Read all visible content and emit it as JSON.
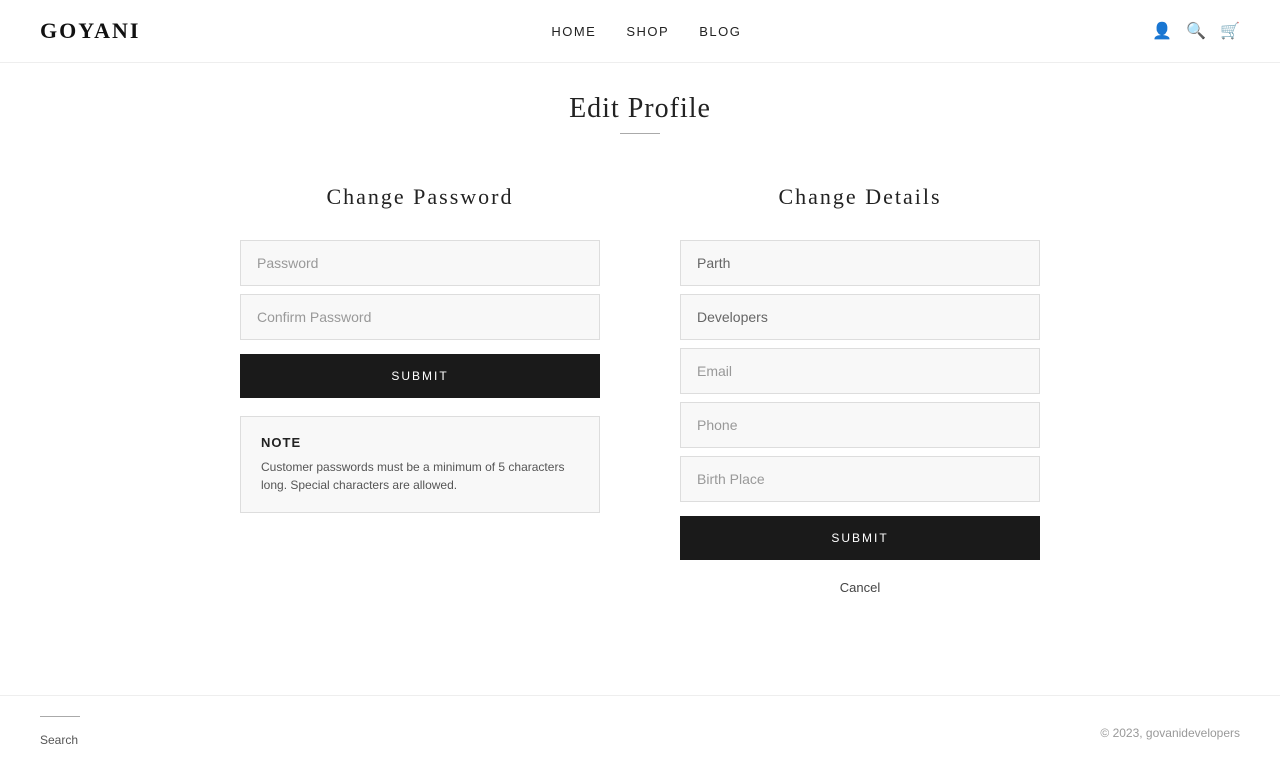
{
  "brand": {
    "logo": "GOYANI"
  },
  "nav": {
    "links": [
      {
        "label": "HOME",
        "id": "home"
      },
      {
        "label": "SHOP",
        "id": "shop"
      },
      {
        "label": "BLOG",
        "id": "blog"
      }
    ],
    "icons": {
      "account": "👤",
      "search": "🔍",
      "cart": "🛒"
    }
  },
  "page": {
    "title": "Edit Profile"
  },
  "change_password": {
    "section_title": "Change Password",
    "password_placeholder": "Password",
    "confirm_placeholder": "Confirm Password",
    "submit_label": "SUBMIT",
    "note": {
      "title": "NOTE",
      "text": "Customer passwords must be a minimum of 5 characters long. Special characters are allowed."
    }
  },
  "change_details": {
    "section_title": "Change Details",
    "first_name_value": "Parth",
    "last_name_value": "Developers",
    "email_placeholder": "Email",
    "phone_placeholder": "Phone",
    "birth_place_placeholder": "Birth Place",
    "submit_label": "SUBMIT",
    "cancel_label": "Cancel"
  },
  "footer": {
    "search_label": "Search",
    "copyright": "© 2023, govanidevelopers"
  }
}
